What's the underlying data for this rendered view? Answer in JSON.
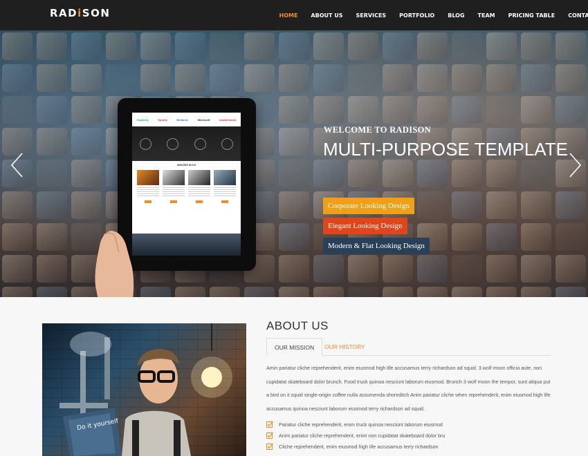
{
  "brand": {
    "logo_pre": "RAD",
    "logo_dot": "i",
    "logo_post": "SON"
  },
  "nav": [
    {
      "label": "HOME",
      "active": true
    },
    {
      "label": "ABOUT US"
    },
    {
      "label": "SERVICES"
    },
    {
      "label": "PORTFOLIO"
    },
    {
      "label": "BLOG"
    },
    {
      "label": "TEAM"
    },
    {
      "label": "PRICING TABLE"
    },
    {
      "label": "CONTACT"
    }
  ],
  "hero": {
    "welcome": "WELCOME TO RADISON",
    "headline": "MULTI-PURPOSE TEMPLATE",
    "pills": [
      "Corporate Looking Design",
      "Elegant Looking Design",
      "Modern & Flat Looking Design"
    ],
    "tablet_logos": [
      "Squarely",
      "Spotify",
      "Behance",
      "Microsoft",
      "shutterstock"
    ],
    "tablet_blog_title": "AMAZING BLOG"
  },
  "about": {
    "title": "ABOUT US",
    "tabs": [
      "OUR MISSION",
      "OUR HISTORY"
    ],
    "paragraph": "Amin pariatur cliche reprehenderit, enim eiusmod high life accusamus terry richardson ad squid. 3 wolf moon officia aute, non cupidatat skateboard dolor brunch. Food truck quinoa nesciunt laborum eiusmod. Brunch 3 wolf moon the tempor, sunt aliqua put a bird on it squid single-origin coffee nulla assumenda shoreditch Anim pariatur cliche when reprehenderit, enim eiusmod high life accusamus quinoa nesciunt laborum eiusmod terry richardson ad squid.",
    "checklist": [
      "Pariatur cliche reprehenderit, enim truck quinoa nesciunt laborum eiusmod",
      "Anim pariatur cliche reprehenderit, enim non cupidatat skateboard dolor bru",
      "Cliche reprehenderit, enim eiusmod high life accusamus terry richardson"
    ],
    "poster_text": "Do it yourself"
  },
  "colors": {
    "accent": "#f28c28",
    "nav_bg": "#1f1f1f",
    "pill1": "#f0a018",
    "pill2": "#e0461a",
    "pill3": "#2a4058"
  }
}
